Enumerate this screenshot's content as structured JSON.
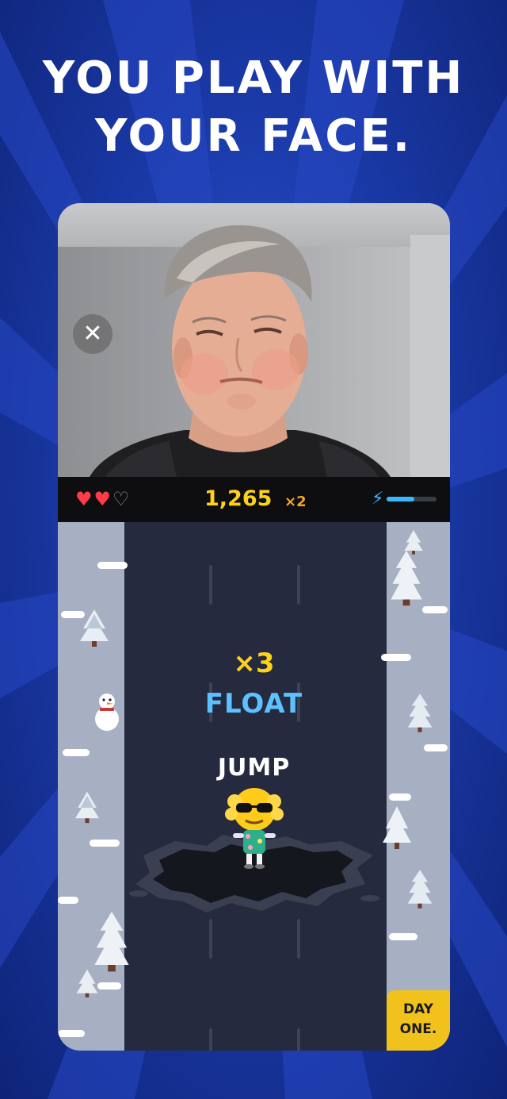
{
  "headline": {
    "line1": "YOU PLAY WITH",
    "line2": "YOUR FACE."
  },
  "camera": {
    "close_label": "✕"
  },
  "hud": {
    "hearts_full": "♥♥",
    "hearts_empty": "♡",
    "score": "1,265",
    "multiplier": "×2",
    "energy_icon": "⚡",
    "energy_level": 0.55
  },
  "game": {
    "combo": "×3",
    "powerup": "FLOAT",
    "action": "JUMP",
    "brand_line1": "DAY",
    "brand_line2": "ONE."
  },
  "colors": {
    "background": "#1a3aa8",
    "score": "#ffd21a",
    "float": "#5cc1ff",
    "heart": "#ff3b4a",
    "brand_badge": "#f2c21c"
  },
  "icons": [
    "close-icon",
    "heart-icon",
    "bolt-icon",
    "tree-icon",
    "snowman-icon",
    "player-emoji-icon"
  ]
}
